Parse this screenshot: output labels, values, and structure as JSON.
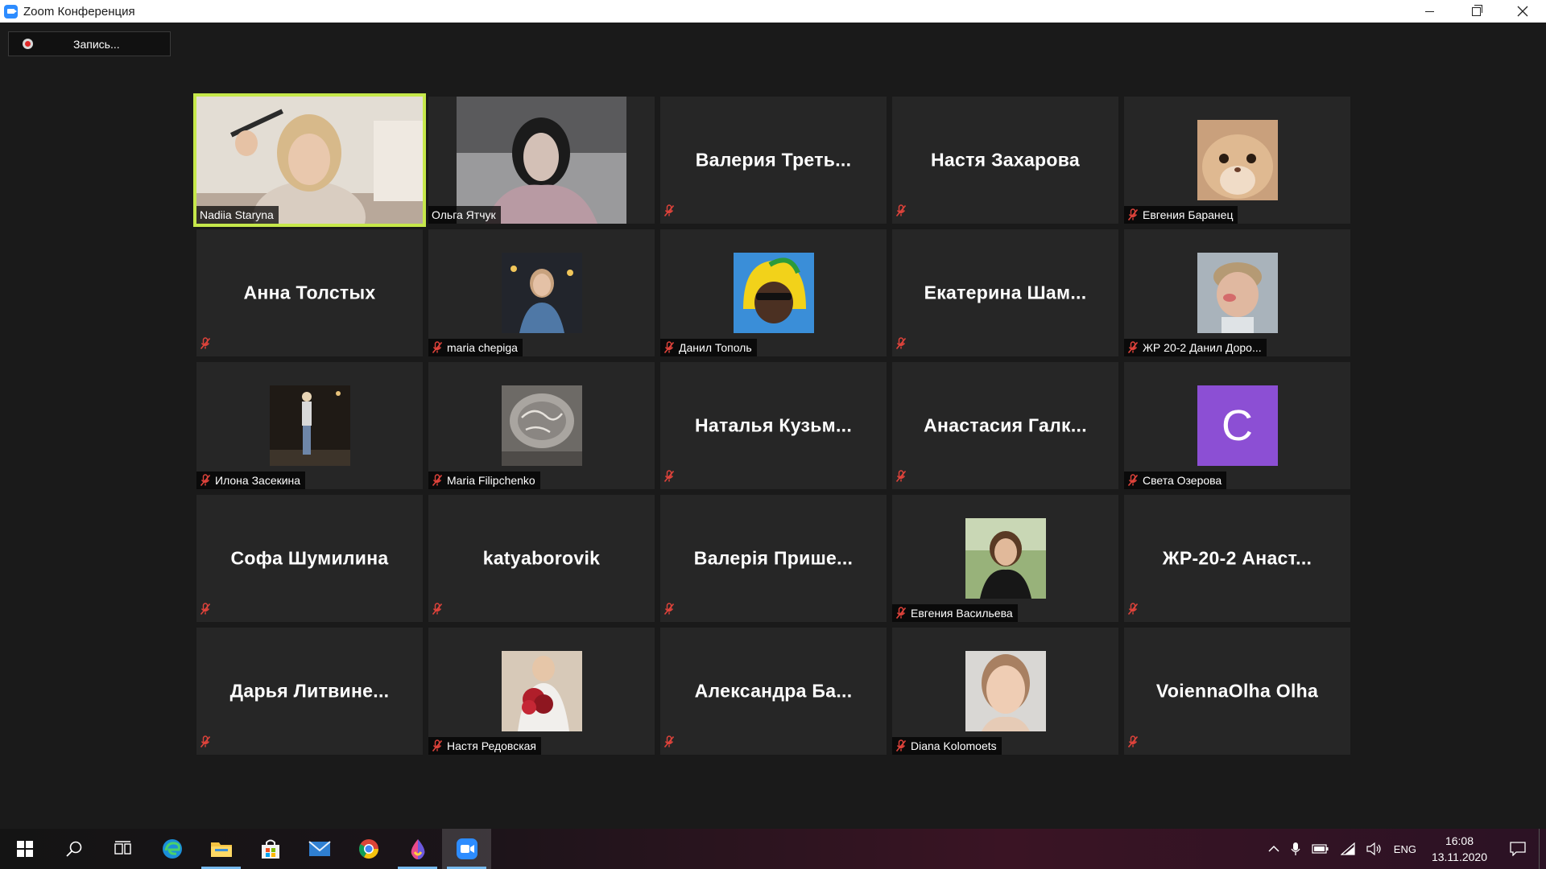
{
  "window": {
    "title": "Zoom Конференция"
  },
  "recording": {
    "label": "Запись..."
  },
  "participants": [
    {
      "display": "Nadiia Staryna",
      "tag": "Nadiia Staryna",
      "kind": "video",
      "muted": false,
      "active": true
    },
    {
      "display": "Ольга Ятчук",
      "tag": "Ольга Ятчук",
      "kind": "video",
      "muted": false,
      "active": false
    },
    {
      "display": "Валерия Треть...",
      "tag": "",
      "kind": "name",
      "muted": true
    },
    {
      "display": "Настя Захарова",
      "tag": "",
      "kind": "name",
      "muted": true
    },
    {
      "display": "",
      "tag": "Евгения Баранец",
      "kind": "photo",
      "muted": true
    },
    {
      "display": "Анна Толстых",
      "tag": "",
      "kind": "name",
      "muted": true
    },
    {
      "display": "",
      "tag": "maria chepiga",
      "kind": "photo",
      "muted": true
    },
    {
      "display": "",
      "tag": "Данил Тополь",
      "kind": "photo",
      "muted": true
    },
    {
      "display": "Екатерина Шам...",
      "tag": "",
      "kind": "name",
      "muted": true
    },
    {
      "display": "",
      "tag": "ЖР 20-2 Данил Доро...",
      "kind": "photo",
      "muted": true
    },
    {
      "display": "",
      "tag": "Илона Засекина",
      "kind": "photo",
      "muted": true
    },
    {
      "display": "",
      "tag": "Maria Filipchenko",
      "kind": "photo",
      "muted": true
    },
    {
      "display": "Наталья Кузьм...",
      "tag": "",
      "kind": "name",
      "muted": true
    },
    {
      "display": "Анастасия Галк...",
      "tag": "",
      "kind": "name",
      "muted": true
    },
    {
      "display": "C",
      "tag": "Света Озерова",
      "kind": "letter",
      "muted": true
    },
    {
      "display": "Софа Шумилина",
      "tag": "",
      "kind": "name",
      "muted": true
    },
    {
      "display": "katyaborovik",
      "tag": "",
      "kind": "name",
      "muted": true
    },
    {
      "display": "Валерія Прише...",
      "tag": "",
      "kind": "name",
      "muted": true
    },
    {
      "display": "",
      "tag": "Евгения Васильева",
      "kind": "photo",
      "muted": true
    },
    {
      "display": "ЖР-20-2 Анаст...",
      "tag": "",
      "kind": "name",
      "muted": true
    },
    {
      "display": "Дарья Литвине...",
      "tag": "",
      "kind": "name",
      "muted": true
    },
    {
      "display": "",
      "tag": "Настя Редовская",
      "kind": "photo",
      "muted": true
    },
    {
      "display": "Александра Ба...",
      "tag": "",
      "kind": "name",
      "muted": true
    },
    {
      "display": "",
      "tag": "Diana Kolomoets",
      "kind": "photo",
      "muted": true
    },
    {
      "display": "VoiennaOlha Olha",
      "tag": "",
      "kind": "name",
      "muted": true
    }
  ],
  "taskbar": {
    "language": "ENG",
    "time": "16:08",
    "date": "13.11.2020"
  },
  "colors": {
    "active_speaker_border": "#c6e84a",
    "muted_icon": "#e0433b",
    "tile_bg": "#262626",
    "letter_avatar": "#8c4fd4"
  }
}
